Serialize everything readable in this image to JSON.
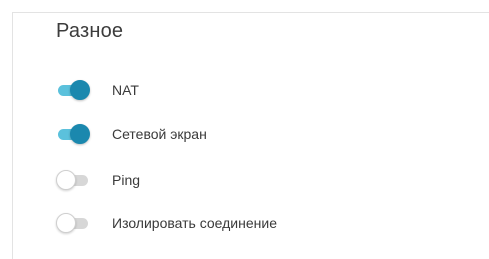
{
  "section": {
    "title": "Разное"
  },
  "toggles": [
    {
      "label": "NAT",
      "enabled": true
    },
    {
      "label": "Сетевой экран",
      "enabled": true
    },
    {
      "label": "Ping",
      "enabled": false
    },
    {
      "label": "Изолировать соединение",
      "enabled": false
    }
  ],
  "colors": {
    "toggle_on_knob": "#1b88ae",
    "toggle_on_track": "#5bc1dc",
    "toggle_off_track": "#d7d7d7",
    "toggle_off_knob": "#ffffff"
  }
}
